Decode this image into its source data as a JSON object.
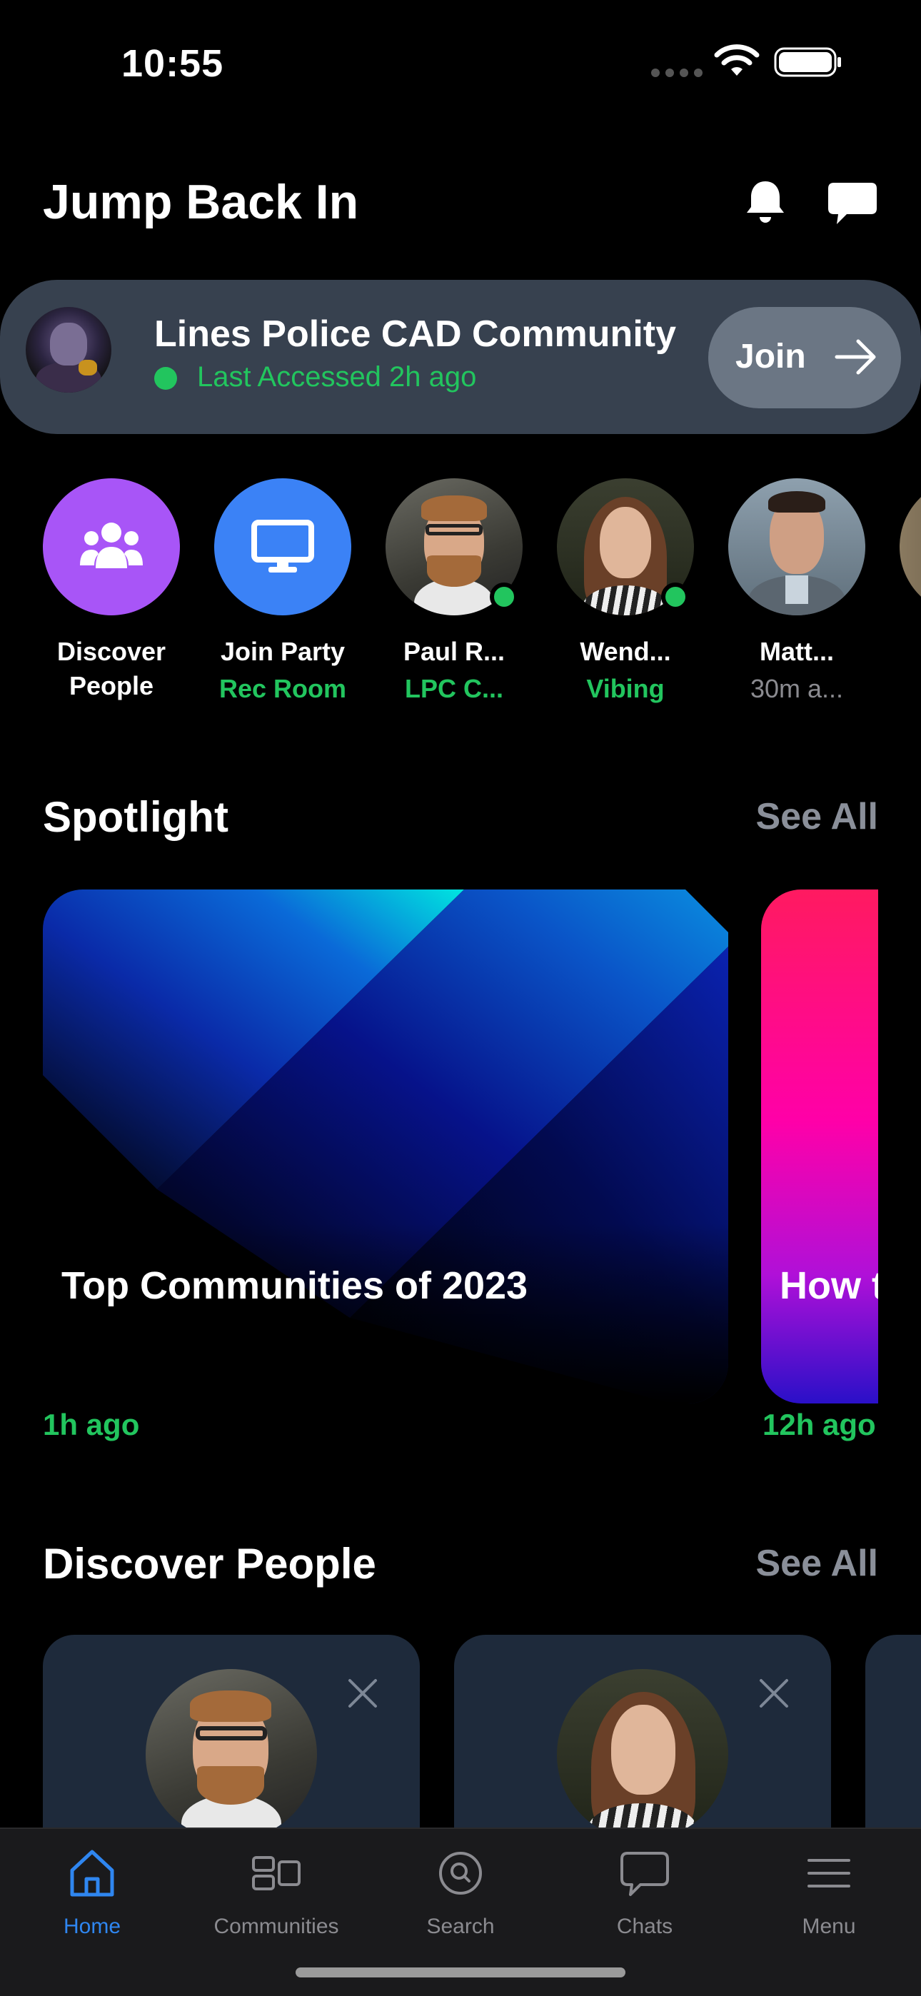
{
  "status_bar": {
    "time": "10:55"
  },
  "header": {
    "title": "Jump Back In"
  },
  "jump_card": {
    "community_name": "Lines Police CAD Community",
    "status": "Last Accessed 2h ago",
    "join_label": "Join"
  },
  "quick_row": [
    {
      "label": "Discover",
      "sub": "People",
      "sub_style": "white"
    },
    {
      "label": "Join Party",
      "sub": "Rec Room",
      "sub_style": "green"
    },
    {
      "label": "Paul R...",
      "sub": "LPC C...",
      "sub_style": "green"
    },
    {
      "label": "Wend...",
      "sub": "Vibing",
      "sub_style": "green"
    },
    {
      "label": "Matt...",
      "sub": "30m a...",
      "sub_style": "gray"
    }
  ],
  "spotlight": {
    "title": "Spotlight",
    "see_all": "See All",
    "cards": [
      {
        "caption": "Top Communities of 2023",
        "time": "1h ago"
      },
      {
        "caption": "How t",
        "time": "12h ago"
      }
    ]
  },
  "discover": {
    "title": "Discover People",
    "see_all": "See All"
  },
  "bottom_nav": [
    {
      "label": "Home",
      "icon": "home-icon",
      "active": true
    },
    {
      "label": "Communities",
      "icon": "communities-icon"
    },
    {
      "label": "Search",
      "icon": "search-icon"
    },
    {
      "label": "Chats",
      "icon": "chats-icon"
    },
    {
      "label": "Menu",
      "icon": "menu-icon"
    }
  ],
  "colors": {
    "accent_green": "#22c55e",
    "accent_blue": "#2f86f0",
    "discover_purple": "#a855f7",
    "party_blue": "#3b82f6",
    "card_bg": "#37414f"
  }
}
